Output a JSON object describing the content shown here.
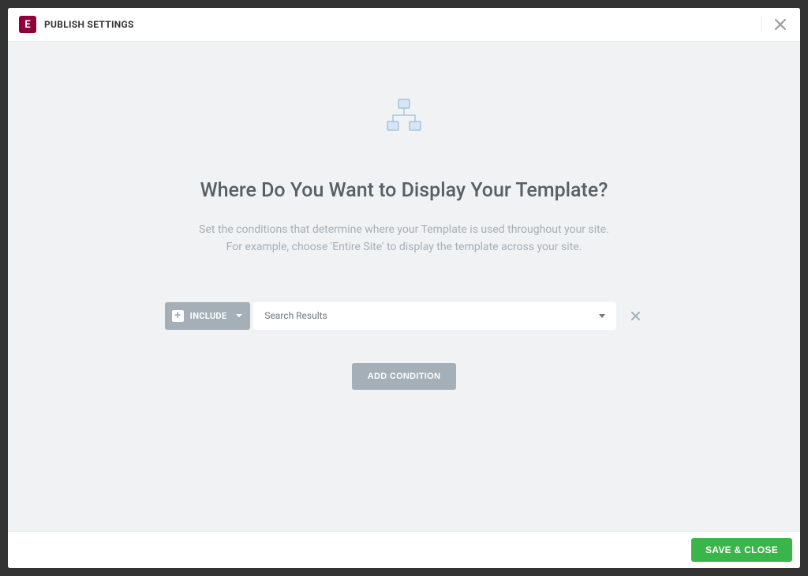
{
  "header": {
    "logo_letter": "E",
    "title": "PUBLISH SETTINGS"
  },
  "content": {
    "heading": "Where Do You Want to Display Your Template?",
    "description_line1": "Set the conditions that determine where your Template is used throughout your site.",
    "description_line2": "For example, choose 'Entire Site' to display the template across your site."
  },
  "condition": {
    "type_label": "INCLUDE",
    "value": "Search Results"
  },
  "buttons": {
    "add_condition": "ADD CONDITION",
    "save_close": "SAVE & CLOSE"
  }
}
